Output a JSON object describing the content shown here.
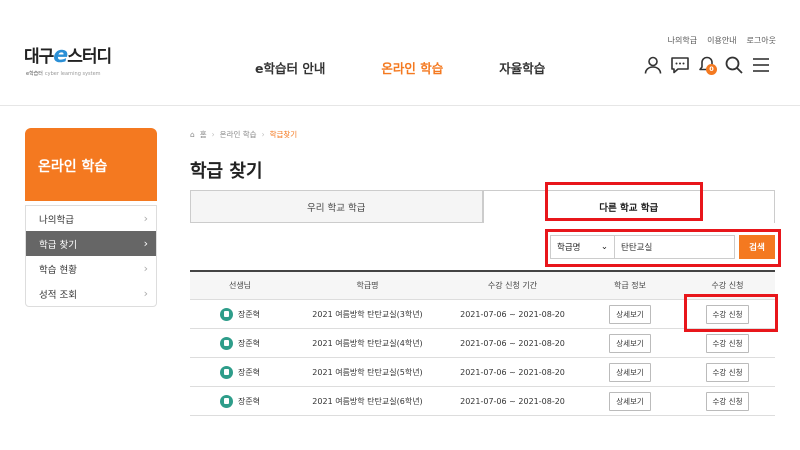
{
  "logo": {
    "main_left": "대구",
    "main_e": "e",
    "main_right": "스터디",
    "sub": "e학습터",
    "sub_small": "cyber learning system"
  },
  "util_links": [
    "나의학급",
    "이용안내",
    "로그아웃"
  ],
  "gnb": [
    "e학습터 안내",
    "온라인 학습",
    "자율학습"
  ],
  "notification_count": "0",
  "sidebar": {
    "title": "온라인 학습",
    "items": [
      {
        "label": "나의학급"
      },
      {
        "label": "학급 찾기"
      },
      {
        "label": "학습 현황"
      },
      {
        "label": "성적 조회"
      }
    ]
  },
  "breadcrumb": {
    "home": "홈",
    "level1": "온라인 학습",
    "current": "학급찾기"
  },
  "page_title": "학급 찾기",
  "tabs": [
    "우리 학교 학급",
    "다른 학교 학급"
  ],
  "search": {
    "select": "학급명",
    "value": "탄탄교실",
    "button": "검색"
  },
  "table": {
    "headers": [
      "선생님",
      "학급명",
      "수강 신청 기간",
      "학급 정보",
      "수강 신청"
    ],
    "rows": [
      {
        "teacher": "장준혁",
        "class": "2021 여름방학 탄탄교실(3학년)",
        "period": "2021-07-06 ~ 2021-08-20",
        "info": "상세보기",
        "apply": "수강 신청"
      },
      {
        "teacher": "장준혁",
        "class": "2021 여름방학 탄탄교실(4학년)",
        "period": "2021-07-06 ~ 2021-08-20",
        "info": "상세보기",
        "apply": "수강 신청"
      },
      {
        "teacher": "장준혁",
        "class": "2021 여름방학 탄탄교실(5학년)",
        "period": "2021-07-06 ~ 2021-08-20",
        "info": "상세보기",
        "apply": "수강 신청"
      },
      {
        "teacher": "장준혁",
        "class": "2021 여름방학 탄탄교실(6학년)",
        "period": "2021-07-06 ~ 2021-08-20",
        "info": "상세보기",
        "apply": "수강 신청"
      }
    ]
  },
  "colors": {
    "accent": "#f47920",
    "highlight": "#e8161b",
    "teacher_icon": "#2e9d8a"
  }
}
